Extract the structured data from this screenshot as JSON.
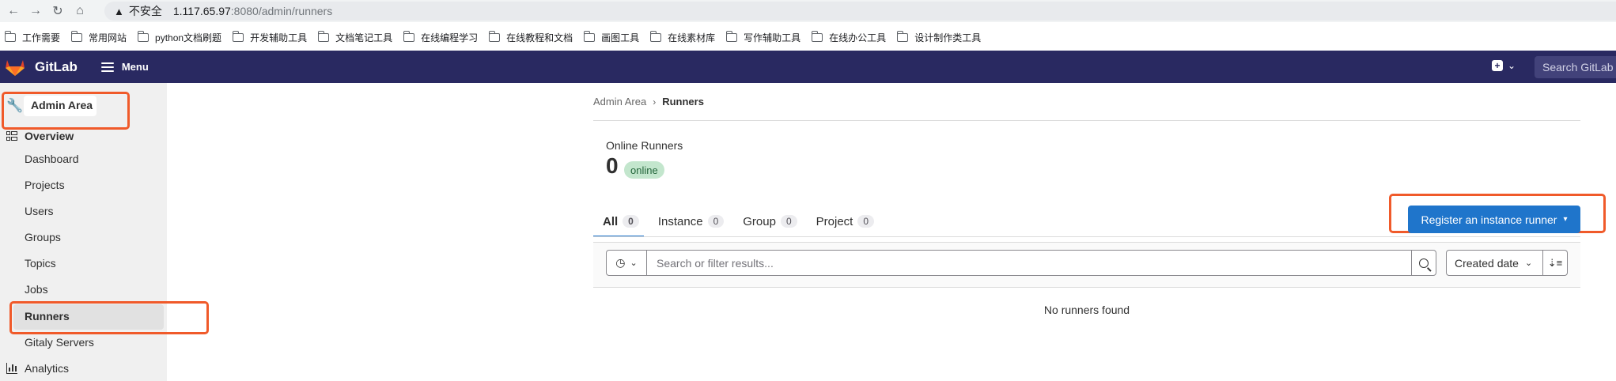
{
  "browser": {
    "insecure_label": "不安全",
    "url_host": "1.117.65.97",
    "url_path": ":8080/admin/runners",
    "bookmarks": [
      "工作需要",
      "常用网站",
      "python文档刷题",
      "开发辅助工具",
      "文档笔记工具",
      "在线编程学习",
      "在线教程和文档",
      "画图工具",
      "在线素材库",
      "写作辅助工具",
      "在线办公工具",
      "设计制作类工具"
    ]
  },
  "header": {
    "brand": "GitLab",
    "menu_label": "Menu",
    "search_placeholder": "Search GitLab"
  },
  "sidebar": {
    "admin_label": "Admin Area",
    "overview_label": "Overview",
    "items": [
      "Dashboard",
      "Projects",
      "Users",
      "Groups",
      "Topics",
      "Jobs",
      "Runners",
      "Gitaly Servers"
    ],
    "analytics_label": "Analytics",
    "active_item": "Runners"
  },
  "breadcrumb": {
    "root": "Admin Area",
    "current": "Runners"
  },
  "stats": {
    "title": "Online Runners",
    "count": "0",
    "badge": "online"
  },
  "tabs": [
    {
      "label": "All",
      "count": "0"
    },
    {
      "label": "Instance",
      "count": "0"
    },
    {
      "label": "Group",
      "count": "0"
    },
    {
      "label": "Project",
      "count": "0"
    }
  ],
  "register_button": "Register an instance runner",
  "filter": {
    "placeholder": "Search or filter results...",
    "sort_label": "Created date"
  },
  "empty_message": "No runners found",
  "colors": {
    "header_bg": "#292961",
    "accent": "#1f75cb",
    "highlight": "#f05a2a",
    "badge_bg": "#c3e6cd"
  }
}
